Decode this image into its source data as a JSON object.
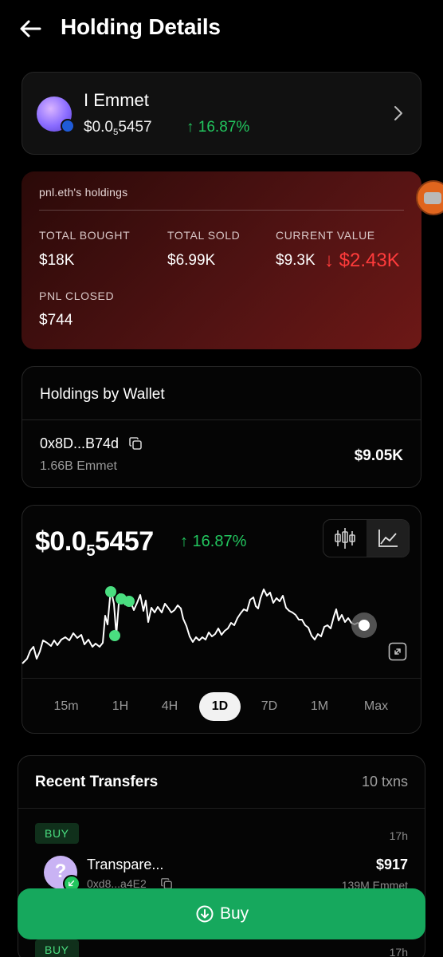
{
  "header": {
    "title": "Holding Details"
  },
  "token": {
    "name": "I Emmet",
    "price_prefix": "$0.0",
    "price_sub": "5",
    "price_suffix": "5457",
    "change": "↑ 16.87%"
  },
  "holdings": {
    "title": "pnl.eth's holdings",
    "total_bought_label": "TOTAL BOUGHT",
    "total_bought": "$18K",
    "total_sold_label": "TOTAL SOLD",
    "total_sold": "$6.99K",
    "current_value_label": "CURRENT VALUE",
    "current_value": "$9.3K",
    "current_value_change": "↓ $2.43K",
    "pnl_closed_label": "PNL CLOSED",
    "pnl_closed": "$744"
  },
  "wallet": {
    "title": "Holdings by Wallet",
    "address": "0x8D...B74d",
    "amount": "1.66B Emmet",
    "value": "$9.05K"
  },
  "chart": {
    "price_prefix": "$0.0",
    "price_sub": "5",
    "price_suffix": "5457",
    "change": "↑ 16.87%",
    "timeframes": [
      "15m",
      "1H",
      "4H",
      "1D",
      "7D",
      "1M",
      "Max"
    ],
    "active_timeframe": "1D"
  },
  "transfers": {
    "title": "Recent Transfers",
    "count": "10 txns",
    "items": [
      {
        "type": "BUY",
        "time": "17h",
        "name": "Transpare...",
        "address": "0xd8...a4E2",
        "value": "$917",
        "amount": "139M Emmet"
      },
      {
        "type": "BUY",
        "time": "17h"
      }
    ]
  },
  "buy_button": {
    "label": "Buy"
  },
  "colors": {
    "accent_green": "#22c55e",
    "loss_red": "#ff3b3b",
    "buy_button": "#16a85d"
  }
}
